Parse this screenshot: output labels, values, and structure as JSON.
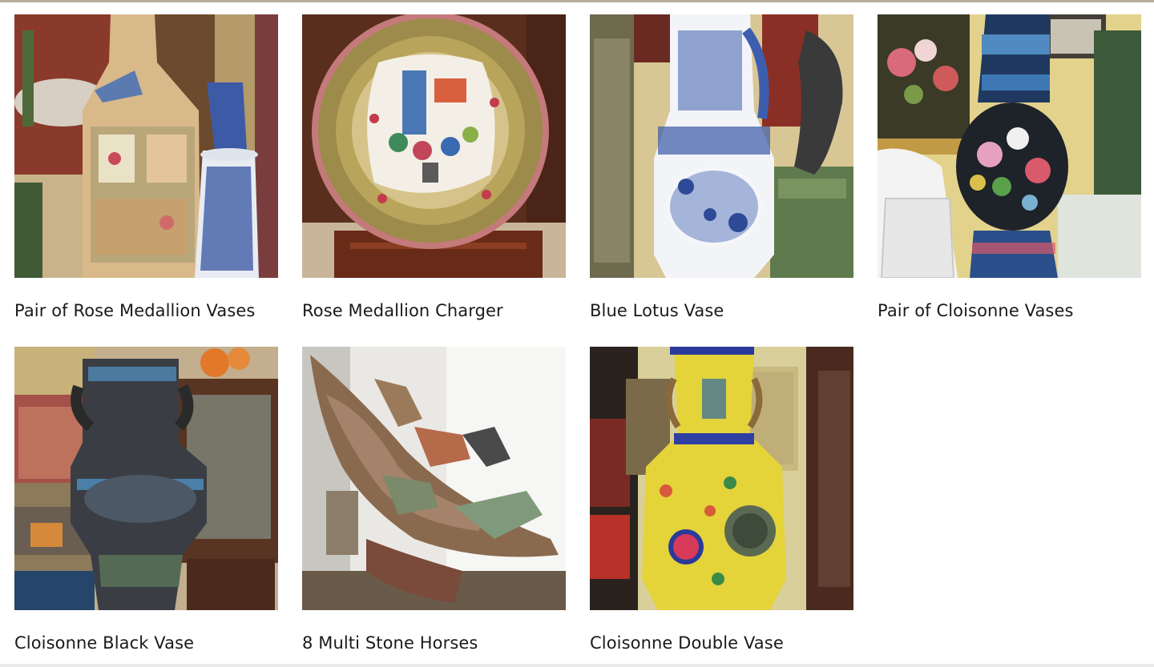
{
  "gallery": {
    "items": [
      {
        "title": "Pair of Rose Medallion Vases",
        "image": "rose-medallion-vases-photo"
      },
      {
        "title": "Rose Medallion Charger",
        "image": "rose-medallion-charger-photo"
      },
      {
        "title": "Blue Lotus Vase",
        "image": "blue-lotus-vase-photo"
      },
      {
        "title": "Pair of Cloisonne Vases",
        "image": "cloisonne-vases-photo"
      },
      {
        "title": "Cloisonne Black Vase",
        "image": "cloisonne-black-vase-photo"
      },
      {
        "title": "8 Multi Stone Horses",
        "image": "multi-stone-horses-photo"
      },
      {
        "title": "Cloisonne Double Vase",
        "image": "cloisonne-double-vase-photo"
      }
    ]
  }
}
